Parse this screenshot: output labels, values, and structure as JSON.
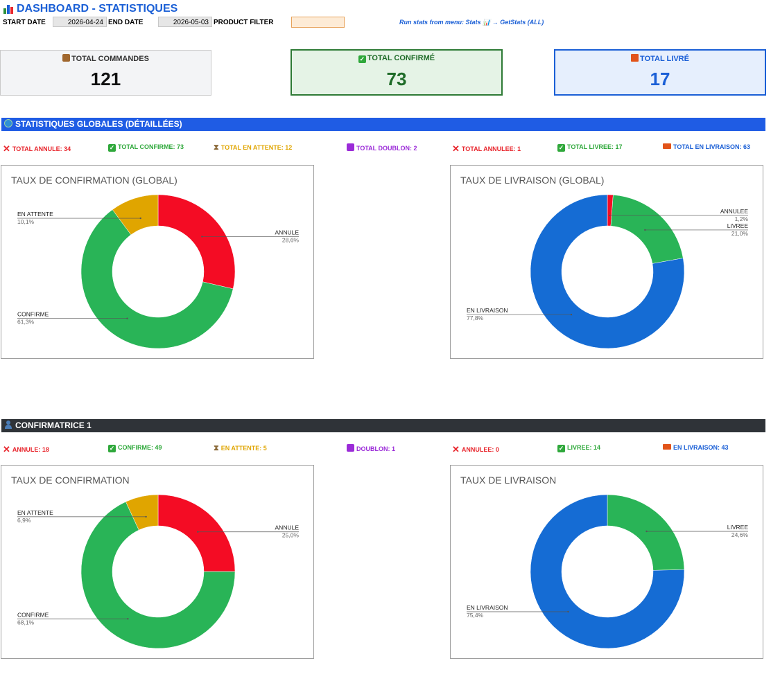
{
  "header": {
    "title": "DASHBOARD - STATISTIQUES",
    "start_label": "START DATE",
    "start_value": "2026-04-24",
    "end_label": "END DATE",
    "end_value": "2026-05-03",
    "filter_label": "PRODUCT FILTER",
    "filter_value": "",
    "hint": "Run stats from menu: Stats 📊 → GetStats (ALL)"
  },
  "kpis": {
    "total_commandes": {
      "label": "TOTAL COMMANDES",
      "value": "121"
    },
    "total_confirme": {
      "label": "TOTAL CONFIRMÉ",
      "value": "73"
    },
    "total_livre": {
      "label": "TOTAL LIVRÉ",
      "value": "17"
    }
  },
  "colors": {
    "annule": "#f40c24",
    "confirme": "#29b457",
    "attente": "#e0a500",
    "livraison": "#156cd4",
    "blue_bar": "#1f5ce4",
    "dark_bar": "#2f3338"
  },
  "global": {
    "section_title": "STATISTIQUES GLOBALES (DÉTAILLÉES)",
    "stats": {
      "annule": "TOTAL ANNULE: 34",
      "confirme": "TOTAL CONFIRME: 73",
      "attente": "TOTAL EN ATTENTE: 12",
      "doublon": "TOTAL DOUBLON: 2",
      "annulee": "TOTAL ANNULEE: 1",
      "livree": "TOTAL LIVREE: 17",
      "livraison": "TOTAL EN LIVRAISON: 63"
    }
  },
  "confirmatrice": {
    "section_title": "CONFIRMATRICE 1",
    "stats": {
      "annule": "ANNULE: 18",
      "confirme": "CONFIRME: 49",
      "attente": "EN ATTENTE: 5",
      "doublon": "DOUBLON: 1",
      "annulee": "ANNULEE: 0",
      "livree": "LIVREE: 14",
      "livraison": "EN LIVRAISON: 43"
    }
  },
  "chart_data": [
    {
      "type": "pie",
      "title": "TAUX DE CONFIRMATION (GLOBAL)",
      "donut": true,
      "slices": [
        {
          "label": "ANNULE",
          "value": 28.6,
          "pct": "28,6%",
          "color": "#f40c24"
        },
        {
          "label": "CONFIRME",
          "value": 61.3,
          "pct": "61,3%",
          "color": "#29b457"
        },
        {
          "label": "EN ATTENTE",
          "value": 10.1,
          "pct": "10,1%",
          "color": "#e0a500"
        }
      ]
    },
    {
      "type": "pie",
      "title": "TAUX DE LIVRAISON (GLOBAL)",
      "donut": true,
      "slices": [
        {
          "label": "ANNULEE",
          "value": 1.2,
          "pct": "1,2%",
          "color": "#f40c24"
        },
        {
          "label": "LIVREE",
          "value": 21.0,
          "pct": "21,0%",
          "color": "#29b457"
        },
        {
          "label": "EN LIVRAISON",
          "value": 77.8,
          "pct": "77,8%",
          "color": "#156cd4"
        }
      ]
    },
    {
      "type": "pie",
      "title": "TAUX DE CONFIRMATION",
      "donut": true,
      "slices": [
        {
          "label": "ANNULE",
          "value": 25.0,
          "pct": "25,0%",
          "color": "#f40c24"
        },
        {
          "label": "CONFIRME",
          "value": 68.1,
          "pct": "68,1%",
          "color": "#29b457"
        },
        {
          "label": "EN ATTENTE",
          "value": 6.9,
          "pct": "6,9%",
          "color": "#e0a500"
        }
      ]
    },
    {
      "type": "pie",
      "title": "TAUX DE LIVRAISON",
      "donut": true,
      "slices": [
        {
          "label": "LIVREE",
          "value": 24.6,
          "pct": "24,6%",
          "color": "#29b457"
        },
        {
          "label": "EN LIVRAISON",
          "value": 75.4,
          "pct": "75,4%",
          "color": "#156cd4"
        }
      ]
    }
  ]
}
